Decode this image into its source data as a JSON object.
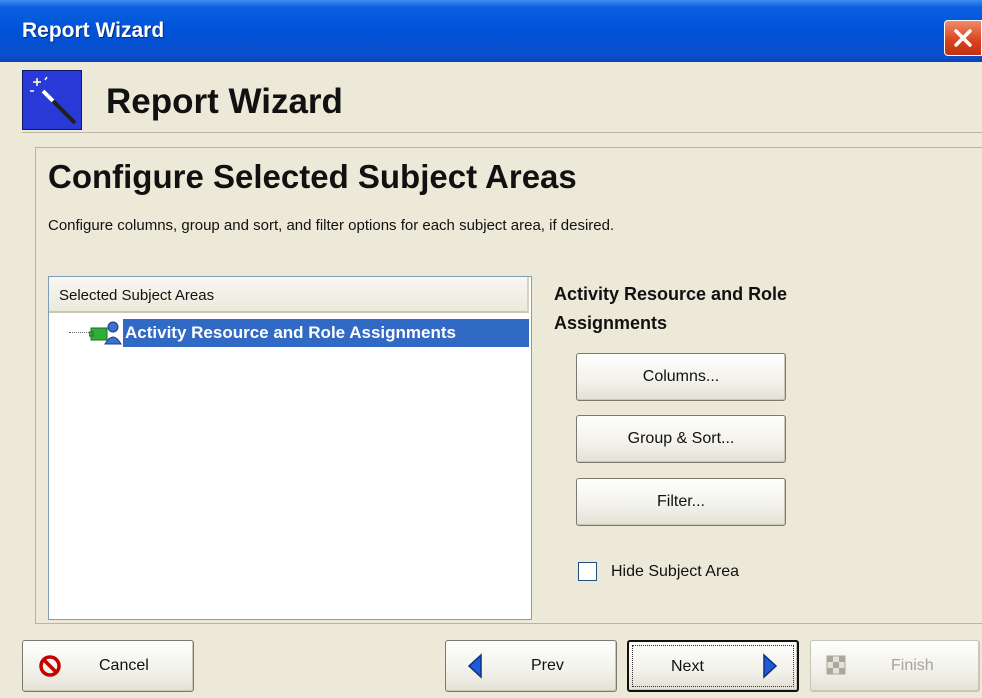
{
  "window": {
    "title": "Report Wizard"
  },
  "header": {
    "title": "Report Wizard",
    "icon": "magic-wand-icon"
  },
  "page": {
    "title": "Configure Selected Subject Areas",
    "description": "Configure columns, group and sort, and filter options for each subject area, if desired."
  },
  "tree": {
    "column_header": "Selected Subject Areas",
    "items": [
      {
        "label": "Activity Resource and Role Assignments",
        "icon": "resource-assignment-icon",
        "selected": true
      }
    ]
  },
  "subject_panel": {
    "title": "Activity Resource and Role Assignments",
    "columns_button": "Columns...",
    "group_sort_button": "Group & Sort...",
    "filter_button": "Filter...",
    "hide_checkbox_label": "Hide Subject Area",
    "hide_checked": false
  },
  "footer": {
    "cancel": "Cancel",
    "prev": "Prev",
    "next": "Next",
    "finish": "Finish"
  },
  "colors": {
    "titlebar": "#0052d6",
    "background": "#ece9d8",
    "selection": "#316ac5",
    "close": "#d8411c",
    "nav_arrow": "#1e5bd8"
  }
}
